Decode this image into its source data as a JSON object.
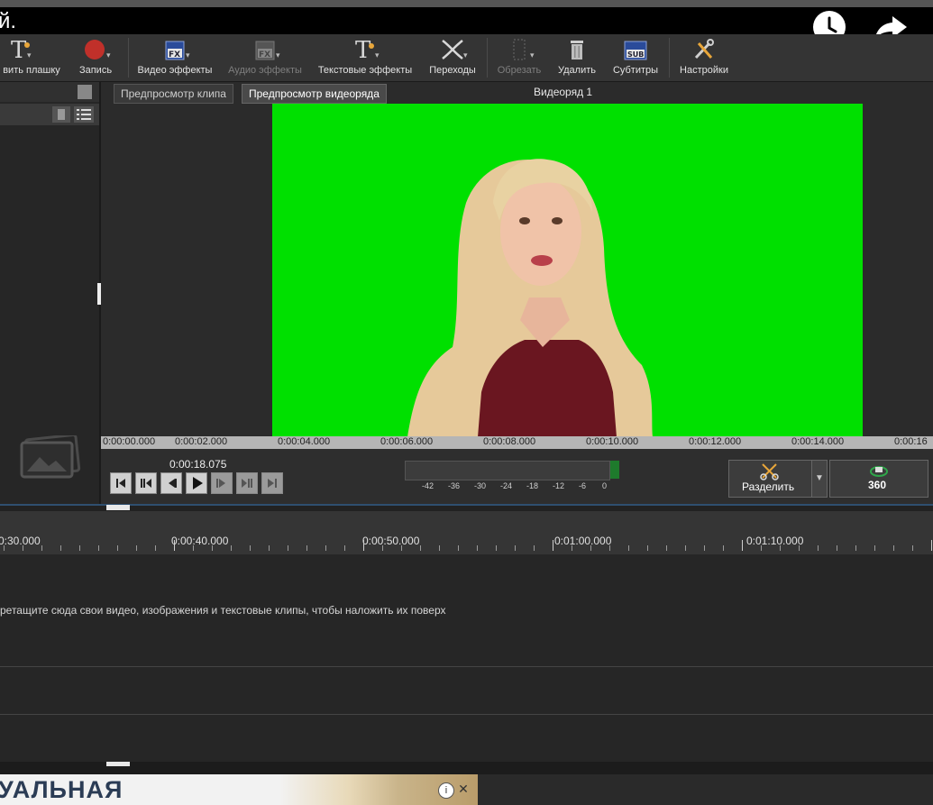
{
  "overlay": {
    "title_fragment": "й."
  },
  "toolbar": {
    "items": [
      {
        "label": "вить плашку",
        "icon": "text-t-icon"
      },
      {
        "label": "Запись",
        "icon": "record-icon"
      },
      {
        "label": "Видео эффекты",
        "icon": "fx-icon"
      },
      {
        "label": "Аудио эффекты",
        "icon": "audio-fx-icon"
      },
      {
        "label": "Текстовые эффекты",
        "icon": "text-effects-icon"
      },
      {
        "label": "Переходы",
        "icon": "transitions-icon"
      },
      {
        "label": "Обрезать",
        "icon": "crop-icon"
      },
      {
        "label": "Удалить",
        "icon": "trash-icon"
      },
      {
        "label": "Субтитры",
        "icon": "subtitles-icon",
        "badge": "SUB"
      },
      {
        "label": "Настройки",
        "icon": "settings-icon"
      }
    ],
    "fx_badge": "FX"
  },
  "preview": {
    "tab_clip": "Предпросмотр клипа",
    "tab_sequence": "Предпросмотр видеоряда",
    "sequence_title": "Видеоряд 1"
  },
  "ruler_top": [
    "0:00:00.000",
    "0:00:02.000",
    "0:00:04.000",
    "0:00:06.000",
    "0:00:08.000",
    "0:00:10.000",
    "0:00:12.000",
    "0:00:14.000",
    "0:00:16"
  ],
  "playback": {
    "timecode": "0:00:18.075",
    "meter_ticks": [
      "-42",
      "-36",
      "-30",
      "-24",
      "-18",
      "-12",
      "-6",
      "0"
    ],
    "split_label": "Разделить",
    "btn_360_label": "360"
  },
  "timeline": {
    "ticks": [
      "0:30.000",
      "0:00:40.000",
      "0:00:50.000",
      "0:01:00.000",
      "0:01:10.000"
    ],
    "overlay_hint": "ретащите сюда свои видео, изображения и текстовые клипы, чтобы наложить их поверх"
  },
  "ad": {
    "text": "УАЛЬНАЯ",
    "info": "i",
    "close": "✕"
  },
  "colors": {
    "chroma_green": "#00e000",
    "toolbar_bg": "#343434",
    "record_red": "#c0302a"
  }
}
